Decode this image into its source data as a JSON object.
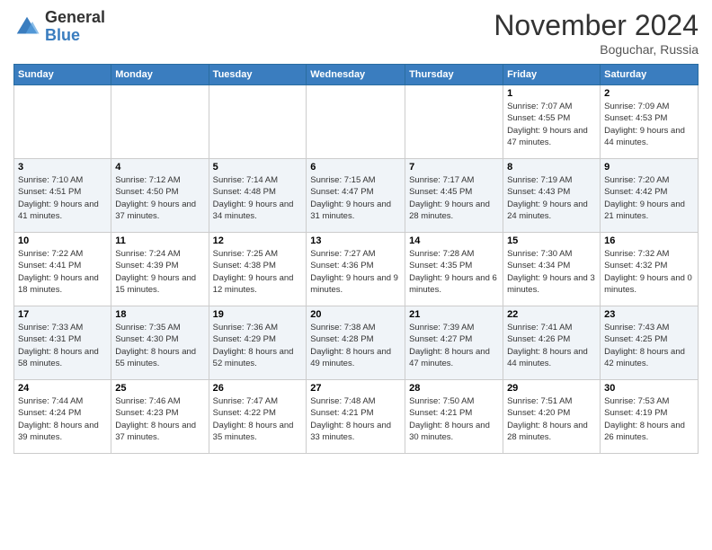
{
  "logo": {
    "general": "General",
    "blue": "Blue"
  },
  "header": {
    "month": "November 2024",
    "location": "Boguchar, Russia"
  },
  "weekdays": [
    "Sunday",
    "Monday",
    "Tuesday",
    "Wednesday",
    "Thursday",
    "Friday",
    "Saturday"
  ],
  "weeks": [
    [
      {
        "day": "",
        "info": ""
      },
      {
        "day": "",
        "info": ""
      },
      {
        "day": "",
        "info": ""
      },
      {
        "day": "",
        "info": ""
      },
      {
        "day": "",
        "info": ""
      },
      {
        "day": "1",
        "info": "Sunrise: 7:07 AM\nSunset: 4:55 PM\nDaylight: 9 hours and 47 minutes."
      },
      {
        "day": "2",
        "info": "Sunrise: 7:09 AM\nSunset: 4:53 PM\nDaylight: 9 hours and 44 minutes."
      }
    ],
    [
      {
        "day": "3",
        "info": "Sunrise: 7:10 AM\nSunset: 4:51 PM\nDaylight: 9 hours and 41 minutes."
      },
      {
        "day": "4",
        "info": "Sunrise: 7:12 AM\nSunset: 4:50 PM\nDaylight: 9 hours and 37 minutes."
      },
      {
        "day": "5",
        "info": "Sunrise: 7:14 AM\nSunset: 4:48 PM\nDaylight: 9 hours and 34 minutes."
      },
      {
        "day": "6",
        "info": "Sunrise: 7:15 AM\nSunset: 4:47 PM\nDaylight: 9 hours and 31 minutes."
      },
      {
        "day": "7",
        "info": "Sunrise: 7:17 AM\nSunset: 4:45 PM\nDaylight: 9 hours and 28 minutes."
      },
      {
        "day": "8",
        "info": "Sunrise: 7:19 AM\nSunset: 4:43 PM\nDaylight: 9 hours and 24 minutes."
      },
      {
        "day": "9",
        "info": "Sunrise: 7:20 AM\nSunset: 4:42 PM\nDaylight: 9 hours and 21 minutes."
      }
    ],
    [
      {
        "day": "10",
        "info": "Sunrise: 7:22 AM\nSunset: 4:41 PM\nDaylight: 9 hours and 18 minutes."
      },
      {
        "day": "11",
        "info": "Sunrise: 7:24 AM\nSunset: 4:39 PM\nDaylight: 9 hours and 15 minutes."
      },
      {
        "day": "12",
        "info": "Sunrise: 7:25 AM\nSunset: 4:38 PM\nDaylight: 9 hours and 12 minutes."
      },
      {
        "day": "13",
        "info": "Sunrise: 7:27 AM\nSunset: 4:36 PM\nDaylight: 9 hours and 9 minutes."
      },
      {
        "day": "14",
        "info": "Sunrise: 7:28 AM\nSunset: 4:35 PM\nDaylight: 9 hours and 6 minutes."
      },
      {
        "day": "15",
        "info": "Sunrise: 7:30 AM\nSunset: 4:34 PM\nDaylight: 9 hours and 3 minutes."
      },
      {
        "day": "16",
        "info": "Sunrise: 7:32 AM\nSunset: 4:32 PM\nDaylight: 9 hours and 0 minutes."
      }
    ],
    [
      {
        "day": "17",
        "info": "Sunrise: 7:33 AM\nSunset: 4:31 PM\nDaylight: 8 hours and 58 minutes."
      },
      {
        "day": "18",
        "info": "Sunrise: 7:35 AM\nSunset: 4:30 PM\nDaylight: 8 hours and 55 minutes."
      },
      {
        "day": "19",
        "info": "Sunrise: 7:36 AM\nSunset: 4:29 PM\nDaylight: 8 hours and 52 minutes."
      },
      {
        "day": "20",
        "info": "Sunrise: 7:38 AM\nSunset: 4:28 PM\nDaylight: 8 hours and 49 minutes."
      },
      {
        "day": "21",
        "info": "Sunrise: 7:39 AM\nSunset: 4:27 PM\nDaylight: 8 hours and 47 minutes."
      },
      {
        "day": "22",
        "info": "Sunrise: 7:41 AM\nSunset: 4:26 PM\nDaylight: 8 hours and 44 minutes."
      },
      {
        "day": "23",
        "info": "Sunrise: 7:43 AM\nSunset: 4:25 PM\nDaylight: 8 hours and 42 minutes."
      }
    ],
    [
      {
        "day": "24",
        "info": "Sunrise: 7:44 AM\nSunset: 4:24 PM\nDaylight: 8 hours and 39 minutes."
      },
      {
        "day": "25",
        "info": "Sunrise: 7:46 AM\nSunset: 4:23 PM\nDaylight: 8 hours and 37 minutes."
      },
      {
        "day": "26",
        "info": "Sunrise: 7:47 AM\nSunset: 4:22 PM\nDaylight: 8 hours and 35 minutes."
      },
      {
        "day": "27",
        "info": "Sunrise: 7:48 AM\nSunset: 4:21 PM\nDaylight: 8 hours and 33 minutes."
      },
      {
        "day": "28",
        "info": "Sunrise: 7:50 AM\nSunset: 4:21 PM\nDaylight: 8 hours and 30 minutes."
      },
      {
        "day": "29",
        "info": "Sunrise: 7:51 AM\nSunset: 4:20 PM\nDaylight: 8 hours and 28 minutes."
      },
      {
        "day": "30",
        "info": "Sunrise: 7:53 AM\nSunset: 4:19 PM\nDaylight: 8 hours and 26 minutes."
      }
    ]
  ]
}
